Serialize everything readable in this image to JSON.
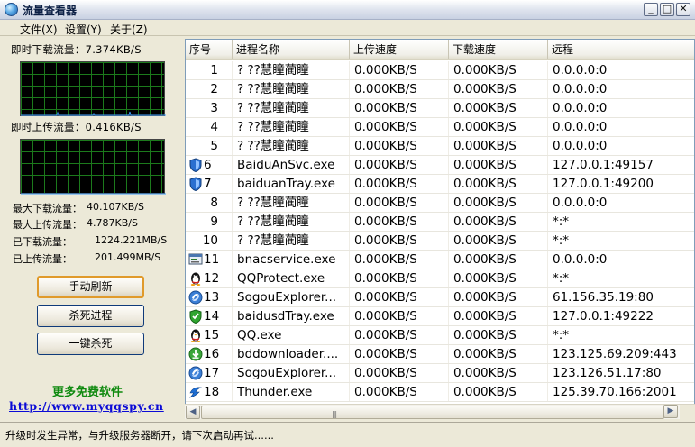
{
  "window": {
    "title": "流量查看器",
    "min": "_",
    "max": "□",
    "close": "✕"
  },
  "menu": {
    "file": "文件(X)",
    "settings": "设置(Y)",
    "about": "关于(Z)"
  },
  "left": {
    "download_rate_label": "即时下载流量：7.374KB/S",
    "upload_rate_label": "即时上传流量：0.416KB/S",
    "stats": [
      {
        "label": "最大下载流量：",
        "value": "40.107KB/S"
      },
      {
        "label": "最大上传流量：",
        "value": "4.787KB/S"
      },
      {
        "label": "已下载流量：",
        "value": "1224.221MB/S"
      },
      {
        "label": "已上传流量：",
        "value": "201.499MB/S"
      }
    ],
    "buttons": {
      "refresh": "手动刷新",
      "kill": "杀死进程",
      "kill_all": "一键杀死"
    },
    "more_text": "更多免费软件",
    "url": "http://www.myqqspy.cn"
  },
  "table": {
    "headers": [
      "序号",
      "进程名称",
      "上传速度",
      "下载速度",
      "远程"
    ],
    "rows": [
      {
        "no": "1",
        "name": "? ??慧瞳蔺瞳",
        "up": "0.000KB/S",
        "down": "0.000KB/S",
        "remote": "0.0.0.0:0",
        "icon": ""
      },
      {
        "no": "2",
        "name": "? ??慧瞳蔺瞳",
        "up": "0.000KB/S",
        "down": "0.000KB/S",
        "remote": "0.0.0.0:0",
        "icon": ""
      },
      {
        "no": "3",
        "name": "? ??慧瞳蔺瞳",
        "up": "0.000KB/S",
        "down": "0.000KB/S",
        "remote": "0.0.0.0:0",
        "icon": ""
      },
      {
        "no": "4",
        "name": "? ??慧瞳蔺瞳",
        "up": "0.000KB/S",
        "down": "0.000KB/S",
        "remote": "0.0.0.0:0",
        "icon": ""
      },
      {
        "no": "5",
        "name": "? ??慧瞳蔺瞳",
        "up": "0.000KB/S",
        "down": "0.000KB/S",
        "remote": "0.0.0.0:0",
        "icon": ""
      },
      {
        "no": "6",
        "name": "BaiduAnSvc.exe",
        "up": "0.000KB/S",
        "down": "0.000KB/S",
        "remote": "127.0.0.1:49157",
        "icon": "shield-icon"
      },
      {
        "no": "7",
        "name": "baiduanTray.exe",
        "up": "0.000KB/S",
        "down": "0.000KB/S",
        "remote": "127.0.0.1:49200",
        "icon": "shield-icon"
      },
      {
        "no": "8",
        "name": "? ??慧瞳蔺瞳",
        "up": "0.000KB/S",
        "down": "0.000KB/S",
        "remote": "0.0.0.0:0",
        "icon": ""
      },
      {
        "no": "9",
        "name": "? ??慧瞳蔺瞳",
        "up": "0.000KB/S",
        "down": "0.000KB/S",
        "remote": "*:*",
        "icon": ""
      },
      {
        "no": "10",
        "name": "? ??慧瞳蔺瞳",
        "up": "0.000KB/S",
        "down": "0.000KB/S",
        "remote": "*:*",
        "icon": ""
      },
      {
        "no": "11",
        "name": "bnacservice.exe",
        "up": "0.000KB/S",
        "down": "0.000KB/S",
        "remote": "0.0.0.0:0",
        "icon": "console-icon"
      },
      {
        "no": "12",
        "name": "QQProtect.exe",
        "up": "0.000KB/S",
        "down": "0.000KB/S",
        "remote": "*:*",
        "icon": "penguin-icon"
      },
      {
        "no": "13",
        "name": "SogouExplorer...",
        "up": "0.000KB/S",
        "down": "0.000KB/S",
        "remote": "61.156.35.19:80",
        "icon": "sogou-icon"
      },
      {
        "no": "14",
        "name": "baidusdTray.exe",
        "up": "0.000KB/S",
        "down": "0.000KB/S",
        "remote": "127.0.0.1:49222",
        "icon": "green-shield-icon"
      },
      {
        "no": "15",
        "name": "QQ.exe",
        "up": "0.000KB/S",
        "down": "0.000KB/S",
        "remote": "*:*",
        "icon": "penguin-icon"
      },
      {
        "no": "16",
        "name": "bddownloader....",
        "up": "0.000KB/S",
        "down": "0.000KB/S",
        "remote": "123.125.69.209:443",
        "icon": "download-icon"
      },
      {
        "no": "17",
        "name": "SogouExplorer...",
        "up": "0.000KB/S",
        "down": "0.000KB/S",
        "remote": "123.126.51.17:80",
        "icon": "sogou-icon"
      },
      {
        "no": "18",
        "name": "Thunder.exe",
        "up": "0.000KB/S",
        "down": "0.000KB/S",
        "remote": "125.39.70.166:2001",
        "icon": "thunder-icon"
      }
    ]
  },
  "scroll": {
    "grip": "|||",
    "left": "◀",
    "right": "▶"
  },
  "status": {
    "text": "升级时发生异常，与升级服务器断开，请下次启动再试......"
  }
}
